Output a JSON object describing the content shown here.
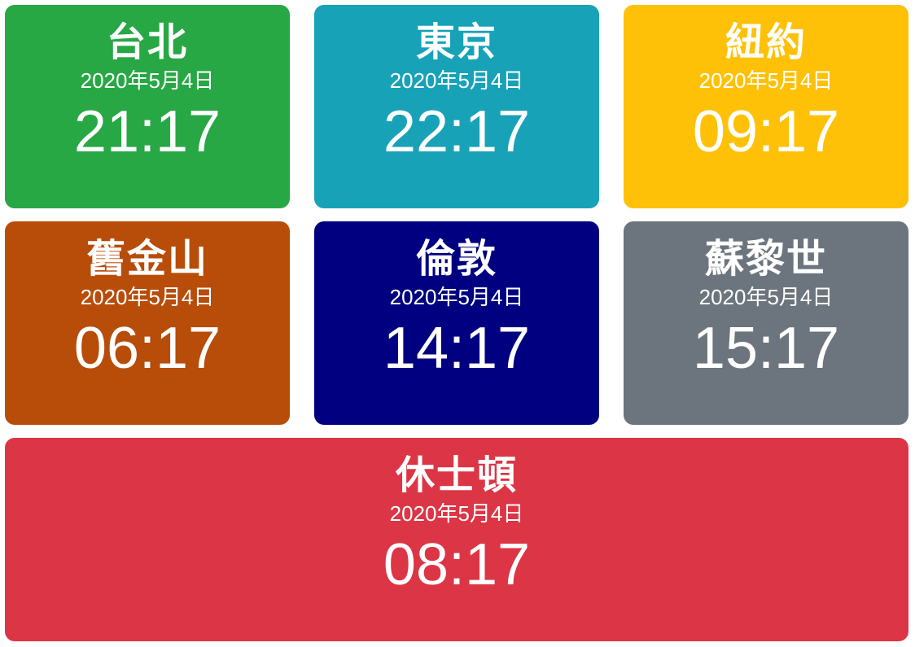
{
  "clocks": [
    {
      "city": "台北",
      "date": "2020年5月4日",
      "time": "21:17",
      "color": "#28a745"
    },
    {
      "city": "東京",
      "date": "2020年5月4日",
      "time": "22:17",
      "color": "#17a2b8"
    },
    {
      "city": "紐約",
      "date": "2020年5月4日",
      "time": "09:17",
      "color": "#ffc107"
    },
    {
      "city": "舊金山",
      "date": "2020年5月4日",
      "time": "06:17",
      "color": "#b84c09"
    },
    {
      "city": "倫敦",
      "date": "2020年5月4日",
      "time": "14:17",
      "color": "#000080"
    },
    {
      "city": "蘇黎世",
      "date": "2020年5月4日",
      "time": "15:17",
      "color": "#6c757d"
    },
    {
      "city": "休士頓",
      "date": "2020年5月4日",
      "time": "08:17",
      "color": "#dc3545"
    }
  ]
}
